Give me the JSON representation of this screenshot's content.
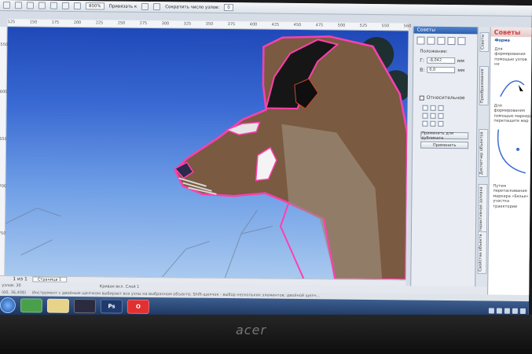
{
  "toolbar": {
    "zoom": "800%",
    "snap_label": "Привязать к",
    "reduce_nodes_label": "Сократить число узлов:",
    "reduce_nodes_value": "0"
  },
  "ruler_top": [
    "125",
    "150",
    "175",
    "200",
    "225",
    "250",
    "275",
    "300",
    "325",
    "350",
    "375",
    "400",
    "425",
    "450",
    "475",
    "500",
    "525",
    "550",
    "560"
  ],
  "ruler_left": [
    "550",
    "600",
    "650",
    "700",
    "750"
  ],
  "pagebar": {
    "page_count": "1 из 1",
    "page_tab": "Страница 1"
  },
  "status": {
    "left": "узлов: 30",
    "center": "Кривая вкл. Слой 1",
    "coords": "(60, 36,408)",
    "hint": "Инструмент с двойным щелчком выбирает все узлы на выбранном объекте; Shift-щелчок - выбор нескольких элементов; двойной щелч..."
  },
  "docker": {
    "title": "Советы",
    "position_label": "Положение:",
    "x_value": "-8,042",
    "y_value": "0,0",
    "unit": "мм",
    "relative_label": "Относительное",
    "apply_dup_label": "Применить для дубликата",
    "apply_label": "Применить"
  },
  "vtabs": [
    "Советы",
    "Преобразования",
    "Диспетчер объектов",
    "Интерактивная заливка",
    "Свойства объекта"
  ],
  "tips": {
    "title": "Советы",
    "section": "Форма",
    "text1": "Для формирования помощью узлов не",
    "text2": "Для формирования помощью маркера перетащите мар",
    "text3": "Путем перетаскивания маркера «Безье» участка траектории"
  },
  "taskbar": {
    "apps": [
      "chrome-icon",
      "folder-icon",
      "corel-icon",
      "photoshop-icon",
      "opera-icon"
    ],
    "ps_label": "Ps",
    "opera_label": "O"
  },
  "bezel": {
    "brand": "acer"
  }
}
